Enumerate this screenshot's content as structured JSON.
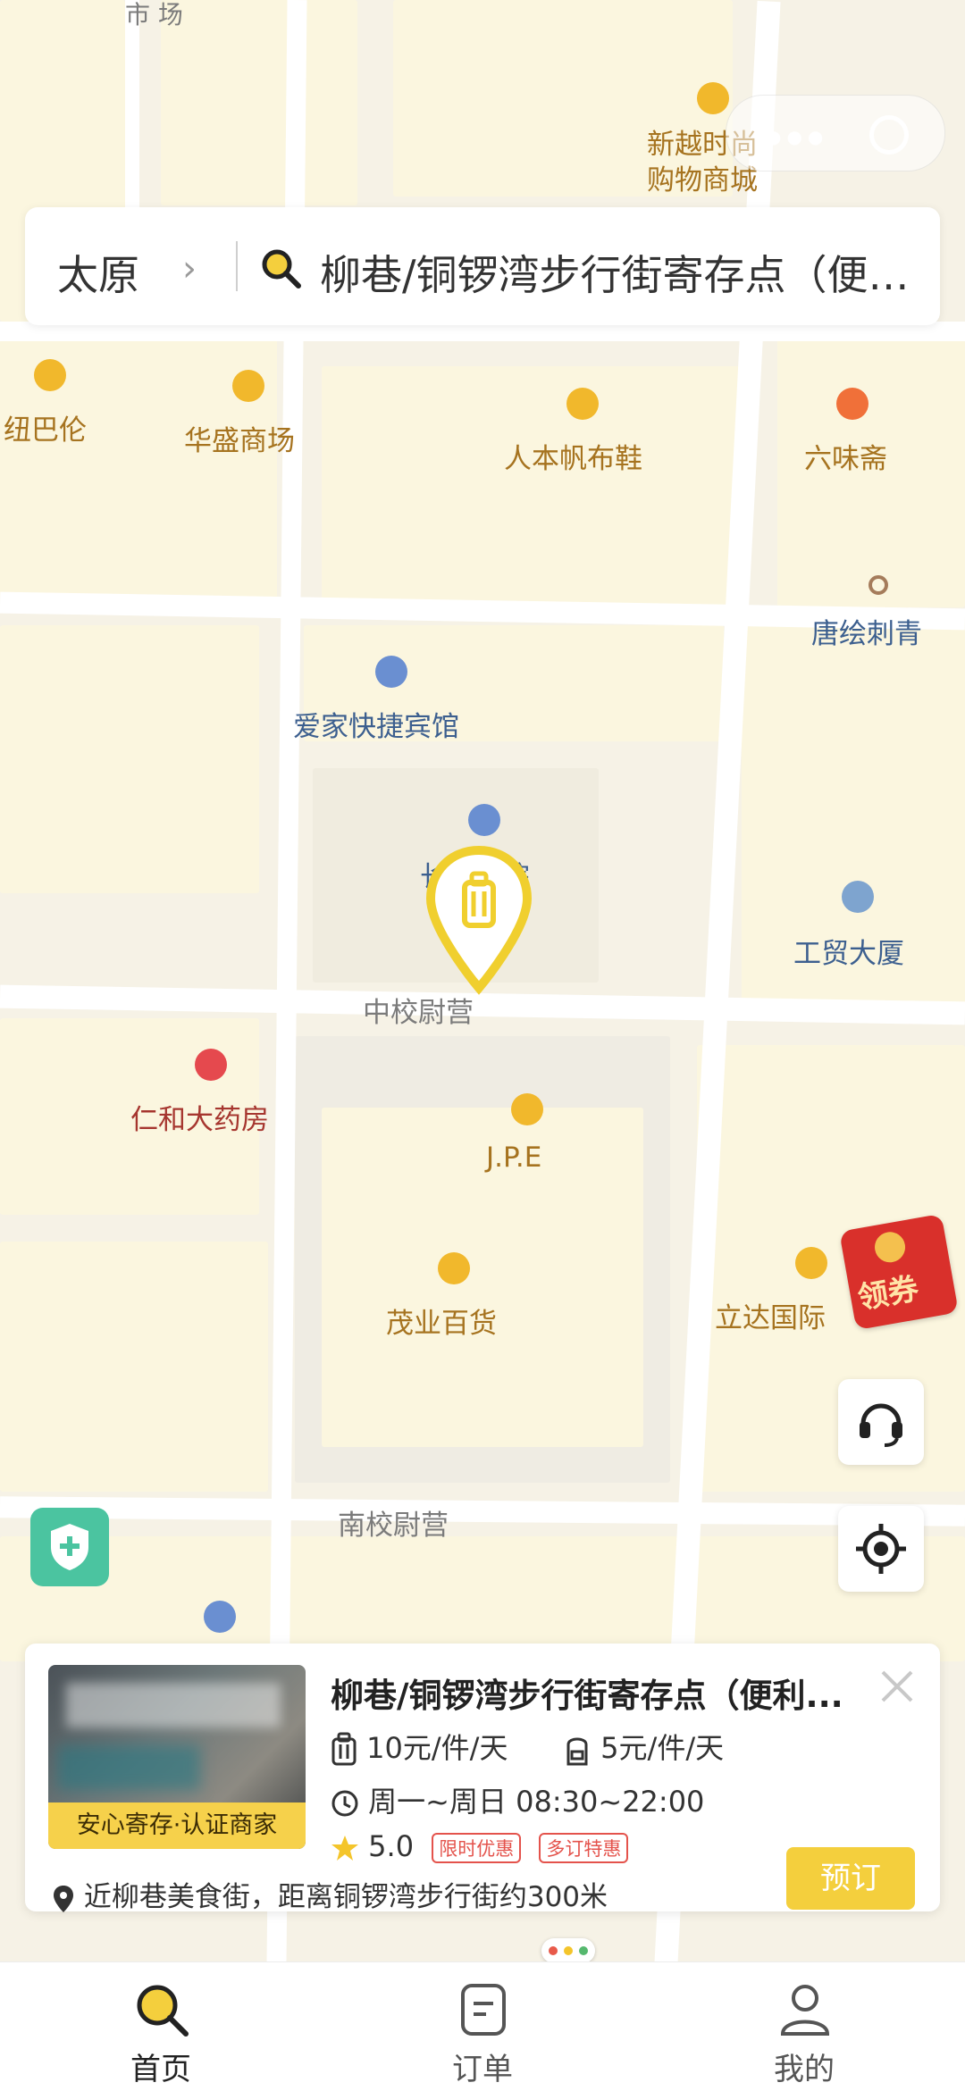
{
  "header": {
    "city": "太原",
    "chevron": "›",
    "search_title": "柳巷/铜锣湾步行街寄存点（便利..."
  },
  "capsule": {
    "more_icon": "more-dots-icon",
    "close_icon": "target-circle-icon"
  },
  "map": {
    "top_labels": {
      "shichang": "市\n场"
    },
    "pois": [
      {
        "id": "xinyue",
        "label": "新越时尚\n购物商城",
        "icon": "shopping-icon"
      },
      {
        "id": "niubalun",
        "label": "纽巴伦",
        "icon": "shopping-icon"
      },
      {
        "id": "huasheng",
        "label": "华盛商场",
        "icon": "shopping-icon"
      },
      {
        "id": "renben",
        "label": "人本帆布鞋",
        "icon": "shopping-icon"
      },
      {
        "id": "liuweizhai",
        "label": "六味斋",
        "icon": "restaurant-icon"
      },
      {
        "id": "tanghui",
        "label": "唐绘刺青",
        "icon": "place-icon"
      },
      {
        "id": "aijia",
        "label": "爱家快捷宾馆",
        "icon": "hotel-icon"
      },
      {
        "id": "juyuan",
        "label": "长   剧院",
        "icon": "music-icon"
      },
      {
        "id": "zhongxiao",
        "label": "中校尉营"
      },
      {
        "id": "gongmao",
        "label": "工贸大厦",
        "icon": "office-icon"
      },
      {
        "id": "renhe",
        "label": "仁和大药房",
        "icon": "pharmacy-icon"
      },
      {
        "id": "jpe",
        "label": "J.P.E",
        "icon": "shopping-icon"
      },
      {
        "id": "maoye",
        "label": "茂业百货",
        "icon": "shopping-icon"
      },
      {
        "id": "lida",
        "label": "立达国际",
        "icon": "shopping-icon"
      },
      {
        "id": "nanxiao",
        "label": "南校尉营"
      }
    ],
    "coupon_label": "领券"
  },
  "card": {
    "title": "柳巷/铜锣湾步行街寄存点（便利...",
    "badge": "安心寄存·认证商家",
    "price_luggage": "10元/件/天",
    "price_bag": "5元/件/天",
    "hours": "周一~周日 08:30~22:00",
    "rating": "5.0",
    "tags": [
      "限时优惠",
      "多订特惠"
    ],
    "address": "近柳巷美食街，距离铜锣湾步行街约300米",
    "book_label": "预订"
  },
  "tabs": [
    {
      "label": "首页",
      "icon": "search-icon",
      "active": true
    },
    {
      "label": "订单",
      "icon": "order-icon",
      "active": false
    },
    {
      "label": "我的",
      "icon": "user-icon",
      "active": false
    }
  ],
  "colors": {
    "accent": "#f4cf3d",
    "poi_text": "#a6731f",
    "tag_red": "#e4534c",
    "shield_green": "#4bc4a0"
  }
}
